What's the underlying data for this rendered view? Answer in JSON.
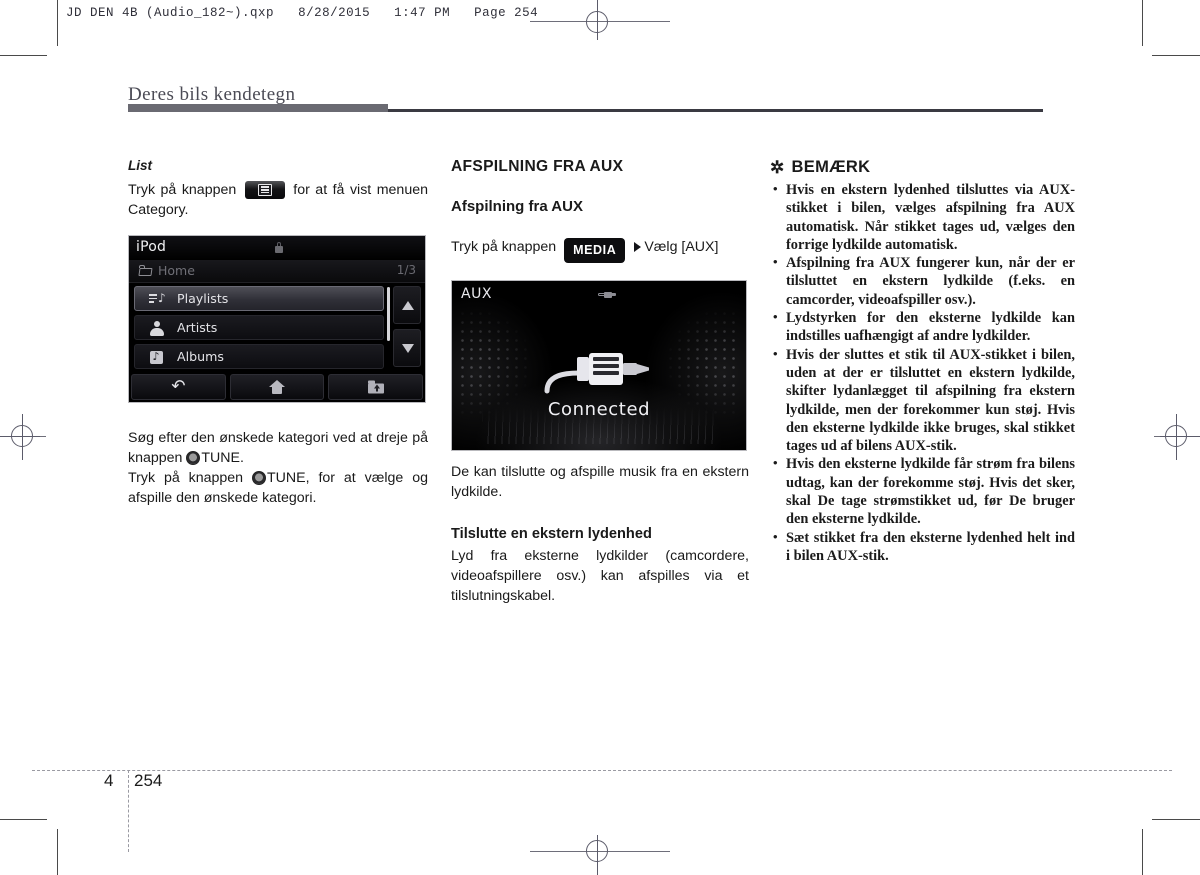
{
  "print_header": {
    "filename": "JD DEN 4B (Audio_182~).qxp",
    "date": "8/28/2015",
    "time": "1:47 PM",
    "page_label": "Page 254"
  },
  "page_title": "Deres bils kendetegn",
  "left_column": {
    "subheading": "List",
    "instruction_part1": "Tryk på knappen",
    "instruction_button_icon": "list-menu-icon",
    "instruction_part2": "for at få vist menuen Category.",
    "after_image_paragraph_1_a": "Søg efter den ønskede kategori ved at dreje på knappen",
    "after_image_paragraph_1_knob": "tune-knob-icon",
    "after_image_paragraph_1_b": "TUNE.",
    "after_image_paragraph_2_a": "Tryk på knappen",
    "after_image_paragraph_2_knob": "tune-knob-icon",
    "after_image_paragraph_2_b": "TUNE, for at vælge og afspille den ønskede kategori."
  },
  "ipod_screen": {
    "title": "iPod",
    "lock_icon": "lock-icon",
    "breadcrumb": "Home",
    "page_indicator": "1/3",
    "rows": [
      {
        "label": "Playlists",
        "icon": "playlist-icon",
        "selected": true
      },
      {
        "label": "Artists",
        "icon": "person-icon",
        "selected": false
      },
      {
        "label": "Albums",
        "icon": "album-icon",
        "selected": false
      }
    ],
    "scroll_up_icon": "arrow-up-icon",
    "scroll_down_icon": "arrow-down-icon",
    "bottom_buttons": [
      {
        "icon": "back-icon"
      },
      {
        "icon": "home-icon"
      },
      {
        "icon": "folder-up-icon"
      }
    ]
  },
  "middle_column": {
    "heading": "AFSPILNING FRA AUX",
    "subheading": "Afspilning fra AUX",
    "step_prefix": "Tryk på knappen",
    "step_button": "MEDIA",
    "step_suffix": "Vælg [AUX]",
    "paragraph_after_image": "De kan tilslutte og afspille musik fra en ekstern lydkilde.",
    "subheading2": "Tilslutte en ekstern lydenhed",
    "paragraph2": "Lyd fra eksterne lydkilder (camcordere, videoafspillere osv.) kan afspilles via et tilslutningskabel."
  },
  "aux_screen": {
    "title": "AUX",
    "status": "Connected",
    "plug_icon": "aux-plug-icon",
    "top_plug_icon": "aux-plug-small-icon"
  },
  "note_panel": {
    "icon": "asterisk-icon",
    "title": "BEMÆRK",
    "bullets": [
      "Hvis en ekstern lydenhed tilsluttes via AUX-stikket i bilen, vælges afspilning fra AUX automatisk. Når stikket tages ud, vælges den forrige lydkilde automatisk.",
      "Afspilning fra AUX fungerer kun, når der er tilsluttet en ekstern lydkilde (f.eks. en camcorder, videoafspiller osv.).",
      "Lydstyrken for den eksterne lydkilde kan indstilles uafhængigt af andre lydkilder.",
      "Hvis der sluttes et stik til AUX-stikket i bilen, uden at der er tilsluttet en ekstern lydkilde, skifter lydanlægget til afspilning fra ekstern lydkilde, men der forekommer kun støj. Hvis den eksterne lydkilde ikke bruges, skal stikket tages ud af bilens AUX-stik.",
      "Hvis den eksterne lydkilde får strøm fra bilens udtag, kan der forekomme støj. Hvis det sker, skal De tage strømstikket ud, før De bruger den eksterne lydkilde.",
      "Sæt stikket fra den eksterne lydenhed helt ind i bilen AUX-stik."
    ]
  },
  "footer": {
    "chapter": "4",
    "page_number": "254"
  },
  "colors": {
    "title_bar_dark": "#6a6a72",
    "title_bar_thin": "#3a3a42",
    "screen_background": "#000000"
  }
}
